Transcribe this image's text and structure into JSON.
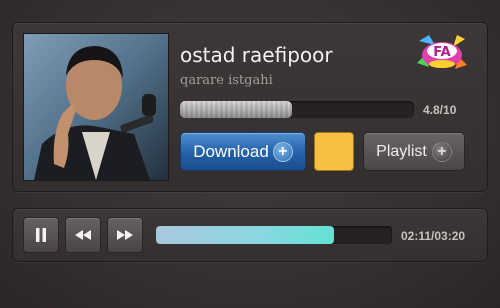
{
  "track": {
    "title": "ostad raefipoor",
    "subtitle": "qarare istgahi",
    "rating_text": "4.8/10",
    "rating_fraction": 0.48,
    "logo_text": "FA"
  },
  "actions": {
    "download_label": "Download",
    "playlist_label": "Playlist",
    "swatch_color": "#f7c042"
  },
  "player": {
    "time_text": "02:11/03:20",
    "progress_fraction": 0.755,
    "progress_color": "#6fe0d6"
  },
  "icons": {
    "pause": "pause-icon",
    "rewind": "rewind-icon",
    "forward": "fast-forward-icon",
    "download_plus": "plus-icon",
    "playlist_plus": "plus-icon"
  }
}
